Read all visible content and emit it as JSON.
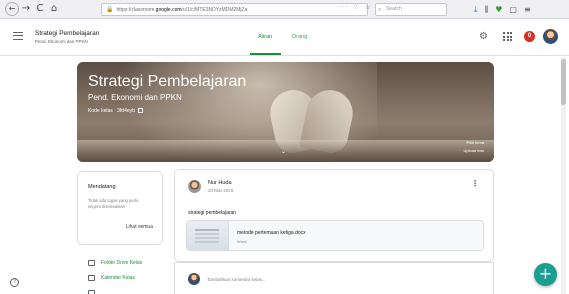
{
  "browser": {
    "back_icon": "←",
    "forward_icon": "→",
    "reload_icon": "C",
    "home_icon": "⌂",
    "url_prefix": "https://classroom.",
    "url_domain": "google.com",
    "url_suffix": "/u/1/c/MTE3NDYzMDM2MjZa",
    "url_actions": "··· ♡ ☆",
    "search_placeholder": "Search"
  },
  "header": {
    "class_name": "Strategi Pembelajaran",
    "class_subtitle": "Pend. Ekonomi dan PPKN",
    "tabs": [
      {
        "label": "Aliran",
        "active": true
      },
      {
        "label": "Orang",
        "active": false
      }
    ],
    "notification_count": "0"
  },
  "banner": {
    "title": "Strategi Pembelajaran",
    "subtitle": "Pend. Ekonomi dan PPKN",
    "code_label": "Kode kelas",
    "code_value": "3fd4eyb",
    "select_theme": "Pilih tema",
    "upload_photo": "Upload foto"
  },
  "upcoming": {
    "title": "Mendatang",
    "empty_text": "Tidak ada tugas yang perlu segera diselesaikan",
    "view_all": "Lihat semua"
  },
  "side_links": [
    {
      "label": "Folder Drive Kelas",
      "icon": "folder-icon"
    },
    {
      "label": "Kalender Kelas",
      "icon": "calendar-icon"
    }
  ],
  "post": {
    "author": "Nur Huda",
    "date": "20 Mar 2019",
    "body": "strategi pembelajaran",
    "attachment_title": "metode pertemuan ketiga.docx",
    "attachment_type": "Word"
  },
  "comment": {
    "placeholder": "Tambahkan komentar kelas..."
  },
  "colors": {
    "accent": "#1e8e3e",
    "fab": "#1a9e8f",
    "badge": "#d93025"
  }
}
